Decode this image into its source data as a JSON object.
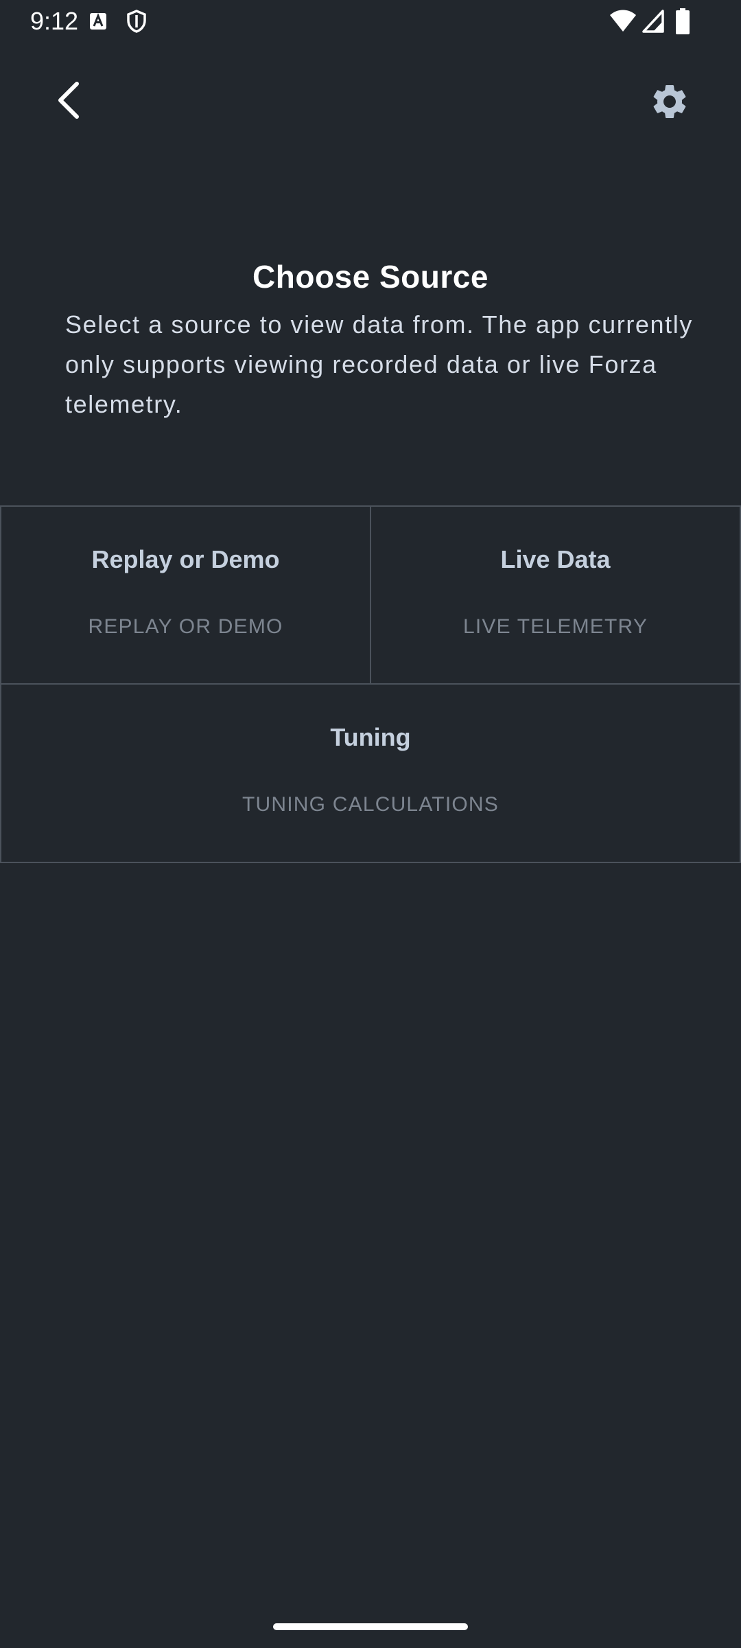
{
  "status_bar": {
    "time": "9:12",
    "icons": [
      "a-notification-icon",
      "shield-icon",
      "wifi-icon",
      "signal-icon",
      "battery-icon"
    ]
  },
  "app_bar": {
    "back_icon": "chevron-left-icon",
    "settings_icon": "gear-icon"
  },
  "header": {
    "title": "Choose Source",
    "description": "Select a source to view data from. The app currently only supports viewing recorded data or live Forza telemetry."
  },
  "sources": [
    {
      "title": "Replay or Demo",
      "subtitle": "REPLAY OR DEMO"
    },
    {
      "title": "Live Data",
      "subtitle": "LIVE TELEMETRY"
    },
    {
      "title": "Tuning",
      "subtitle": "TUNING CALCULATIONS"
    }
  ],
  "colors": {
    "background": "#22272d",
    "card_border": "#4b525b",
    "card_title": "#c5d0de",
    "card_subtitle": "#7d8590",
    "description": "#d6dde8",
    "icon_light": "#ffffff",
    "settings_icon": "#b9c6d6"
  }
}
